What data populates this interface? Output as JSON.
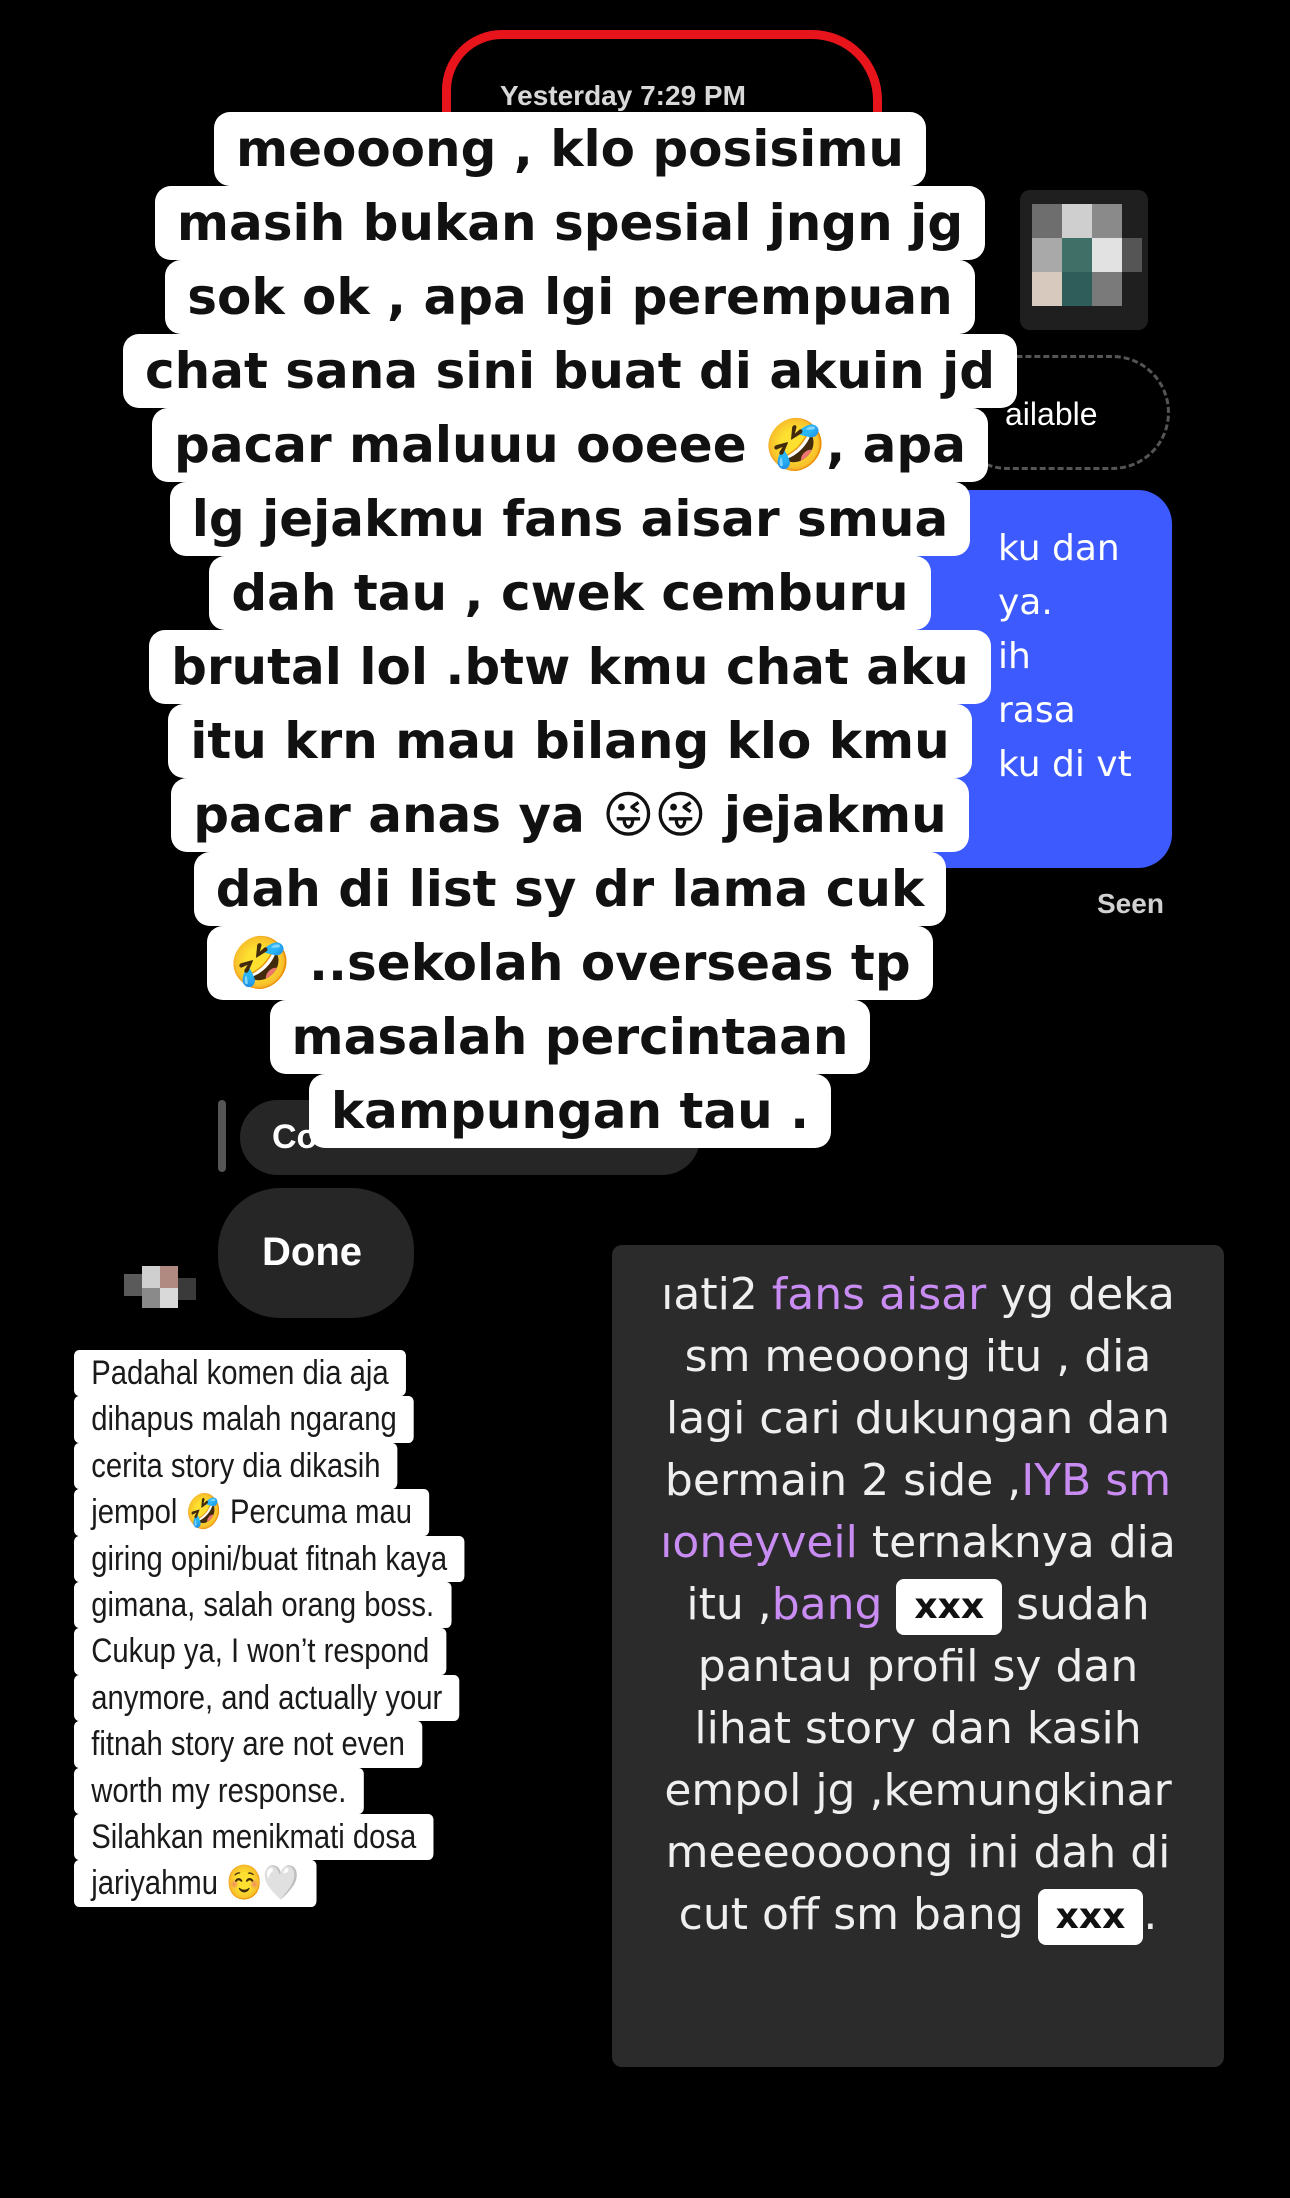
{
  "chat": {
    "timestamp": "Yesterday 7:29 PM",
    "highlight_color": "#e8141b",
    "availability_text": "ailable",
    "outgoing_bubble_color": "#3d5afe",
    "outgoing_fragments": [
      "ku dan",
      "ya.",
      "ih",
      "rasa",
      "ku di vt"
    ],
    "seen_label": "Seen",
    "reply_fragment": "Co",
    "done_label": "Done"
  },
  "caption": {
    "lines": [
      "meooong , klo posisimu",
      "masih bukan spesial jngn jg",
      "sok ok , apa lgi perempuan",
      "chat sana sini buat di akuin jd",
      "pacar maluuu ooeee 🤣, apa",
      "lg jejakmu fans aisar smua",
      "dah tau , cwek cemburu",
      "brutal lol .btw kmu chat aku",
      "itu krn mau bilang klo kmu",
      "pacar anas ya 😜😜 jejakmu",
      "dah di list sy dr lama cuk",
      "🤣 ..sekolah overseas tp",
      "masalah percintaan",
      "kampungan tau ."
    ]
  },
  "note": {
    "lines": [
      "Padahal komen dia aja",
      "dihapus malah ngarang",
      "cerita story dia dikasih",
      "jempol 🤣 Percuma mau",
      "giring opini/buat fitnah kaya",
      "gimana, salah orang boss.",
      "Cukup ya, I won’t respond",
      "anymore, and actually your",
      "fitnah story are not even",
      "worth my response.",
      "Silahkan menikmati dosa",
      "jariyahmu ☺️🤍"
    ]
  },
  "screenshot": {
    "highlight_color": "#c88cf2",
    "l1_a": "ıati2 ",
    "l1_b": "fans aisar",
    "l1_c": " yg deka",
    "l2": "sm meooong itu , dia",
    "l3": "lagi cari dukungan dan",
    "l4_a": "bermain 2 side ,",
    "l4_b": "IYB sm",
    "l5_a": "ıoneyveil",
    "l5_b": " ternaknya dia",
    "l6_a": "itu ,",
    "l6_b": "bang",
    "l6_redact": "xxx",
    "l6_c": " sudah",
    "l7": "pantau profil sy dan",
    "l8": "lihat story dan kasih",
    "l9": "empol jg ,kemungkinar",
    "l10": "meeeoooong ini dah di",
    "l11_a": "cut off sm bang ",
    "l11_redact": "xxx",
    "l11_b": "."
  }
}
